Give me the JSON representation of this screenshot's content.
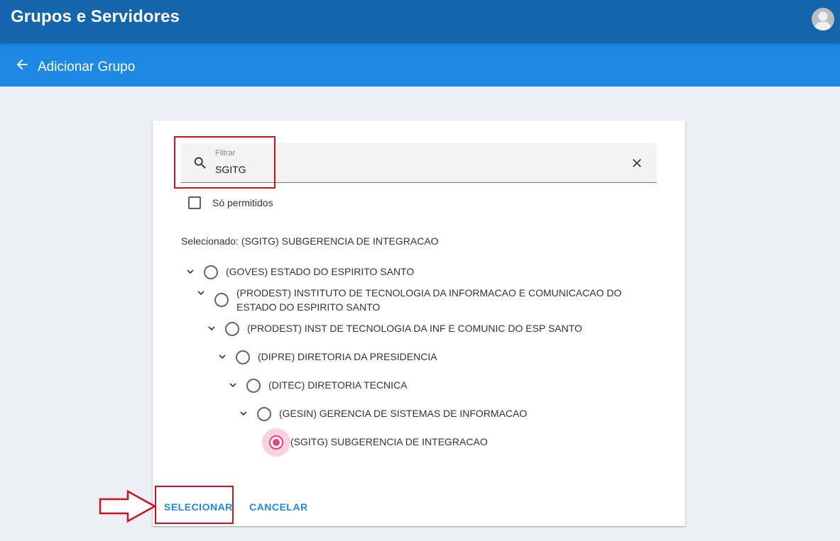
{
  "app": {
    "title": "Grupos e Servidores",
    "avatar_icon": "user-avatar-icon"
  },
  "subheader": {
    "title": "Adicionar Grupo",
    "back_icon": "arrow-left-icon"
  },
  "filter": {
    "label": "Filtrar",
    "value": "SGITG",
    "search_icon": "search-icon",
    "clear_icon": "close-icon"
  },
  "permitted": {
    "label": "Só permitidos",
    "checked": false
  },
  "selection": {
    "text": "Selecionado: (SGITG) SUBGERENCIA DE INTEGRACAO"
  },
  "tree": [
    {
      "label": "(GOVES) ESTADO DO ESPIRITO SANTO",
      "expanded": true,
      "selected": false
    },
    {
      "label": "(PRODEST) INSTITUTO DE TECNOLOGIA DA INFORMACAO E COMUNICACAO DO ESTADO DO ESPIRITO SANTO",
      "expanded": true,
      "selected": false
    },
    {
      "label": "(PRODEST) INST DE TECNOLOGIA DA INF E COMUNIC DO ESP SANTO",
      "expanded": true,
      "selected": false
    },
    {
      "label": "(DIPRE) DIRETORIA DA PRESIDENCIA",
      "expanded": true,
      "selected": false
    },
    {
      "label": "(DITEC) DIRETORIA TECNICA",
      "expanded": true,
      "selected": false
    },
    {
      "label": "(GESIN) GERENCIA DE SISTEMAS DE INFORMACAO",
      "expanded": true,
      "selected": false
    },
    {
      "label": "(SGITG) SUBGERENCIA DE INTEGRACAO",
      "expanded": false,
      "selected": true
    }
  ],
  "actions": {
    "select": "SELECIONAR",
    "cancel": "CANCELAR"
  },
  "colors": {
    "primary_dark": "#1565ad",
    "primary": "#1e88e5",
    "accent": "#ec407a",
    "annotation": "#d0121b"
  }
}
